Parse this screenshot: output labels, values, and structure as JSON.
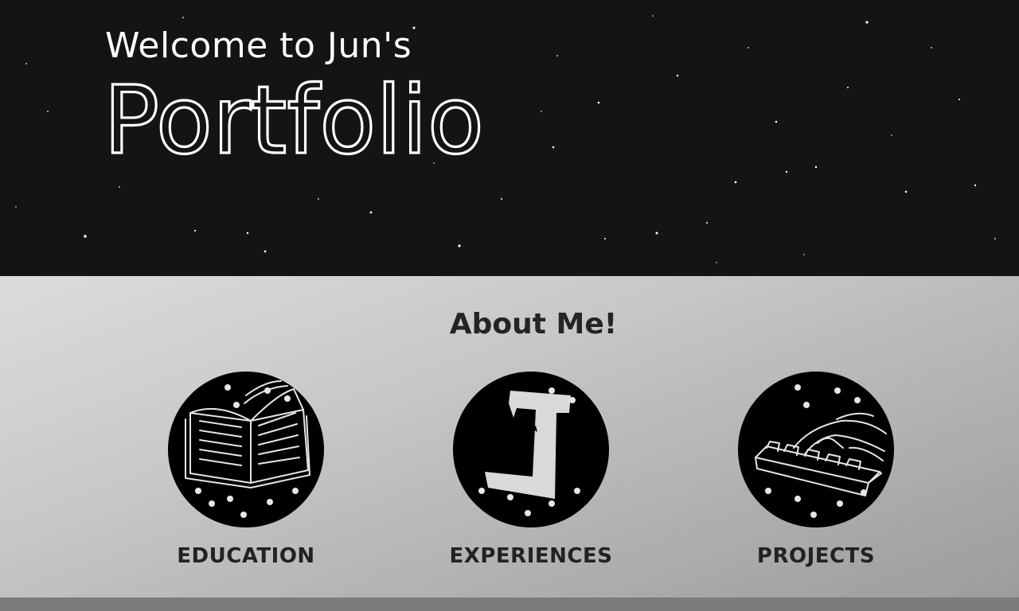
{
  "hero": {
    "welcome_text": "Welcome to Jun's",
    "title_text": "Portfolio",
    "background_color": "#141414"
  },
  "about": {
    "title": "About Me!",
    "cards": [
      {
        "label": "EDUCATION",
        "icon": "open-book-icon"
      },
      {
        "label": "EXPERIENCES",
        "icon": "letter-j-icon"
      },
      {
        "label": "PROJECTS",
        "icon": "keyboard-typing-icon"
      }
    ]
  }
}
